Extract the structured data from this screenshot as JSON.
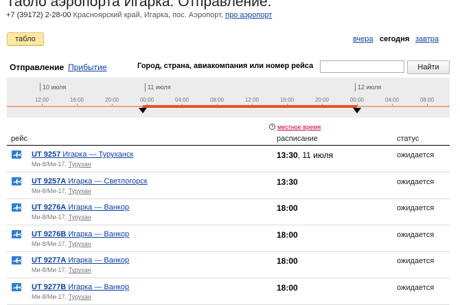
{
  "header": {
    "title": "Табло аэропорта Игарка. Отправление.",
    "phone": "+7 (39172) 2-28-00",
    "address": "Красноярский край, Игарка, пос. Аэропорт,",
    "about_link": "про аэропорт"
  },
  "tablo_button": "табло",
  "days": {
    "yesterday": "вчера",
    "today": "сегодня",
    "tomorrow": "завтра"
  },
  "tabs": {
    "departure": "Отправление",
    "arrival": "Прибытие"
  },
  "search": {
    "label": "Город, страна, авиакомпания или номер рейса",
    "value": "",
    "button": "Найти"
  },
  "timeline": {
    "dates": [
      "10 июля",
      "11 июля",
      "12 июля"
    ],
    "ticks": [
      "12:00",
      "16:00",
      "20:00",
      "00:00",
      "04:00",
      "08:00",
      "12:00",
      "16:00",
      "20:00",
      "00:00",
      "04:00",
      "08:00"
    ],
    "active_color": "#e2531f"
  },
  "local_time_link": "местное время",
  "columns": {
    "flight": "рейс",
    "schedule": "расписание",
    "status": "статус"
  },
  "flights": [
    {
      "number": "UT 9257",
      "route": "Игарка — Туруханск",
      "aircraft": "Ми-8/Ми-17,",
      "via": "Турухан",
      "time": "13:30",
      "date": ", 11 июля",
      "status": "ожидается"
    },
    {
      "number": "UT 9257A",
      "route": "Игарка — Светлогорск",
      "aircraft": "Ми-8/Ми-17,",
      "via": "Турухан",
      "time": "13:30",
      "date": "",
      "status": "ожидается"
    },
    {
      "number": "UT 9276A",
      "route": "Игарка — Ванкор",
      "aircraft": "Ми-8/Ми-17,",
      "via": "Турухан",
      "time": "18:00",
      "date": "",
      "status": "ожидается"
    },
    {
      "number": "UT 9276B",
      "route": "Игарка — Ванкор",
      "aircraft": "Ми-8/Ми-17,",
      "via": "Турухан",
      "time": "18:00",
      "date": "",
      "status": "ожидается"
    },
    {
      "number": "UT 9277A",
      "route": "Игарка — Ванкор",
      "aircraft": "Ми-8/Ми-17,",
      "via": "Турухан",
      "time": "18:00",
      "date": "",
      "status": "ожидается"
    },
    {
      "number": "UT 9277B",
      "route": "Игарка — Ванкор",
      "aircraft": "Ми-8/Ми-17,",
      "via": "Турухан",
      "time": "18:00",
      "date": "",
      "status": "ожидается"
    }
  ]
}
